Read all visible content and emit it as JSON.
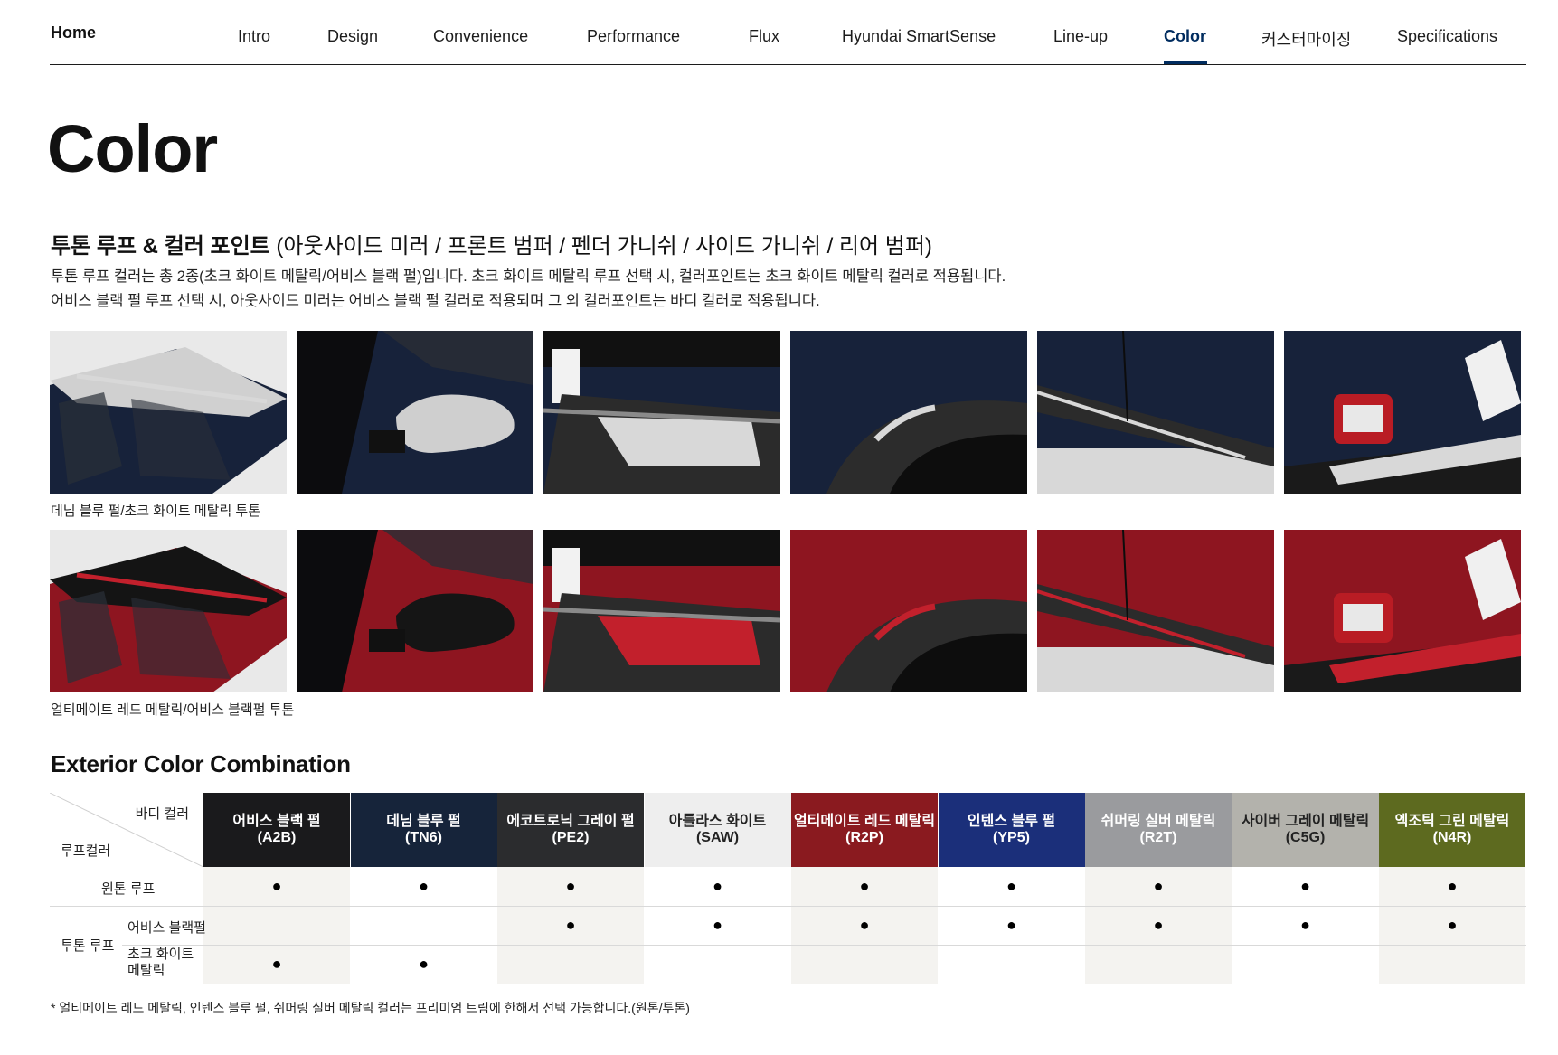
{
  "nav": {
    "home": "Home",
    "items": [
      "Intro",
      "Design",
      "Convenience",
      "Performance",
      "Flux",
      "Hyundai SmartSense",
      "Line-up",
      "Color",
      "커스터마이징",
      "Specifications"
    ],
    "active": "Color",
    "accent": "#002c5f"
  },
  "page_title": "Color",
  "section": {
    "title_bold": "투톤 루프 & 컬러 포인트",
    "title_rest": " (아웃사이드 미러 / 프론트 범퍼 / 펜더 가니쉬 / 사이드 가니쉬 / 리어 범퍼)",
    "desc1": "투톤 루프 컬러는 총 2종(초크 화이트 메탈릭/어비스 블랙 펄)입니다. 초크 화이트 메탈릭 루프 선택 시, 컬러포인트는 초크 화이트 메탈릭 컬러로 적용됩니다.",
    "desc2": "어비스 블랙 펄 루프 선택 시, 아웃사이드 미러는 어비스 블랙 펄 컬러로 적용되며 그 외 컬러포인트는 바디 컬러로 적용됩니다."
  },
  "photo_rows": [
    {
      "caption": "데님 블루 펄/초크 화이트 메탈릭 투톤",
      "body": "#17223a",
      "accent": "#d8d8d8",
      "roof": "#d0d0d0"
    },
    {
      "caption": "얼티메이트 레드 메탈릭/어비스 블랙펄 투톤",
      "body": "#8e1520",
      "accent": "#c2202c",
      "roof": "#141414"
    }
  ],
  "combo": {
    "title": "Exterior Color Combination",
    "corner_body": "바디 컬러",
    "corner_roof": "루프컬러",
    "columns": [
      {
        "name": "어비스 블랙 펄",
        "code": "(A2B)",
        "bg": "#1a1a1c",
        "fg": "#ffffff"
      },
      {
        "name": "데님 블루 펄",
        "code": "(TN6)",
        "bg": "#16243a",
        "fg": "#ffffff"
      },
      {
        "name": "에코트로닉 그레이 펄",
        "code": "(PE2)",
        "bg": "#2b2c2e",
        "fg": "#ffffff"
      },
      {
        "name": "아틀라스 화이트",
        "code": "(SAW)",
        "bg": "#eeeeee",
        "fg": "#222222"
      },
      {
        "name": "얼티메이트 레드 메탈릭",
        "code": "(R2P)",
        "bg": "#8a1a1f",
        "fg": "#ffffff"
      },
      {
        "name": "인텐스 블루 펄",
        "code": "(YP5)",
        "bg": "#1b2f7a",
        "fg": "#ffffff"
      },
      {
        "name": "쉬머링 실버 메탈릭",
        "code": "(R2T)",
        "bg": "#9a9b9e",
        "fg": "#ffffff"
      },
      {
        "name": "사이버 그레이 메탈릭",
        "code": "(C5G)",
        "bg": "#b3b2ac",
        "fg": "#222222"
      },
      {
        "name": "엑조틱 그린 메탈릭",
        "code": "(N4R)",
        "bg": "#5d6a1f",
        "fg": "#ffffff"
      }
    ],
    "rows": [
      {
        "group": "원톤 루프",
        "label": "",
        "marks": [
          true,
          true,
          true,
          true,
          true,
          true,
          true,
          true,
          true
        ]
      },
      {
        "group": "투톤 루프",
        "label": "어비스 블랙펄",
        "marks": [
          false,
          false,
          true,
          true,
          true,
          true,
          true,
          true,
          true
        ]
      },
      {
        "group": "",
        "label": "초크 화이트\n메탈릭",
        "marks": [
          true,
          true,
          false,
          false,
          false,
          false,
          false,
          false,
          false
        ]
      }
    ],
    "mark": "●",
    "footnote": "* 얼티메이트 레드 메탈릭, 인텐스 블루 펄, 쉬머링 실버 메탈릭 컬러는 프리미엄 트림에 한해서 선택 가능합니다.(원톤/투톤)"
  }
}
